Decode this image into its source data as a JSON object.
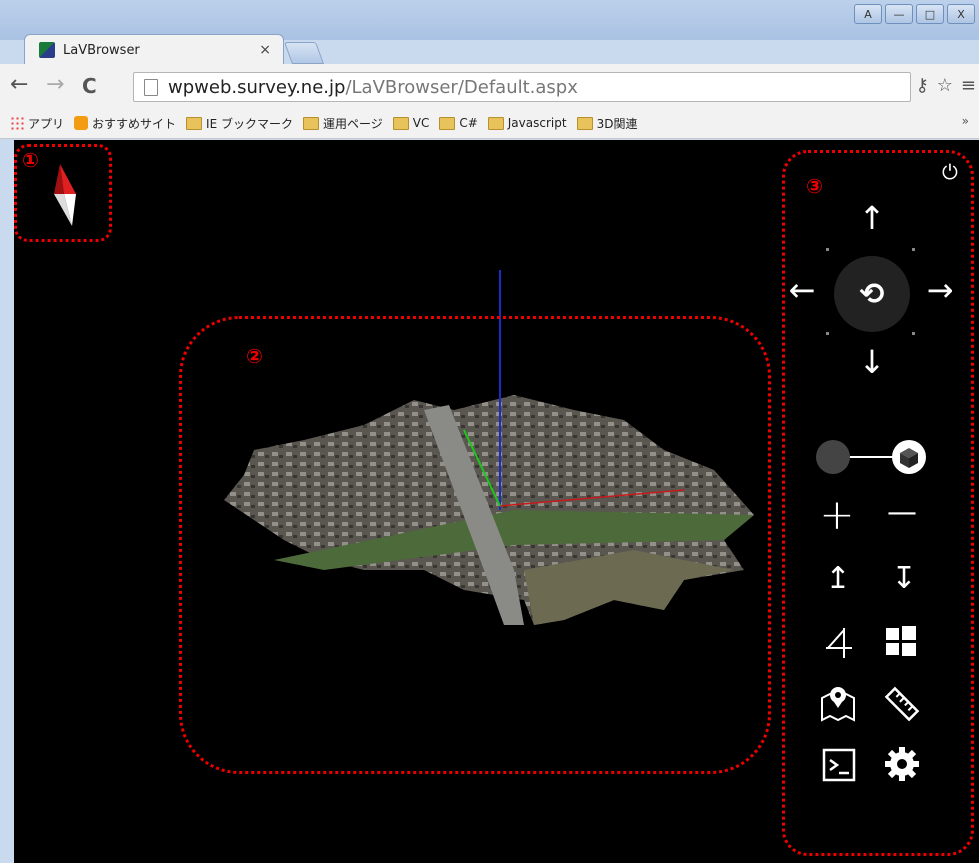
{
  "window": {
    "buttons": [
      "A",
      "—",
      "□",
      "X"
    ]
  },
  "tab": {
    "title": "LaVBrowser",
    "close": "×"
  },
  "toolbar": {
    "back": "←",
    "forward": "→",
    "reload": "C"
  },
  "address": {
    "host": "wpweb.survey.ne.jp",
    "path": "/LaVBrowser/Default.aspx"
  },
  "bookmarks": {
    "items": [
      "アプリ",
      "おすすめサイト",
      "IE ブックマーク",
      "運用ページ",
      "VC",
      "C#",
      "Javascript",
      "3D関連"
    ],
    "more": "»"
  },
  "annotations": {
    "one": "①",
    "two": "②",
    "three": "③"
  },
  "controls": {
    "power": "⏻",
    "up": "↑",
    "down": "↓",
    "left": "←",
    "right": "→",
    "rotate": "⟲",
    "zoom_in": "+",
    "zoom_out": "—",
    "raise": "↥",
    "lower": "↧"
  },
  "colors": {
    "marker": "#e00000",
    "viewport_bg": "#000000",
    "control_fg": "#ffffff"
  }
}
